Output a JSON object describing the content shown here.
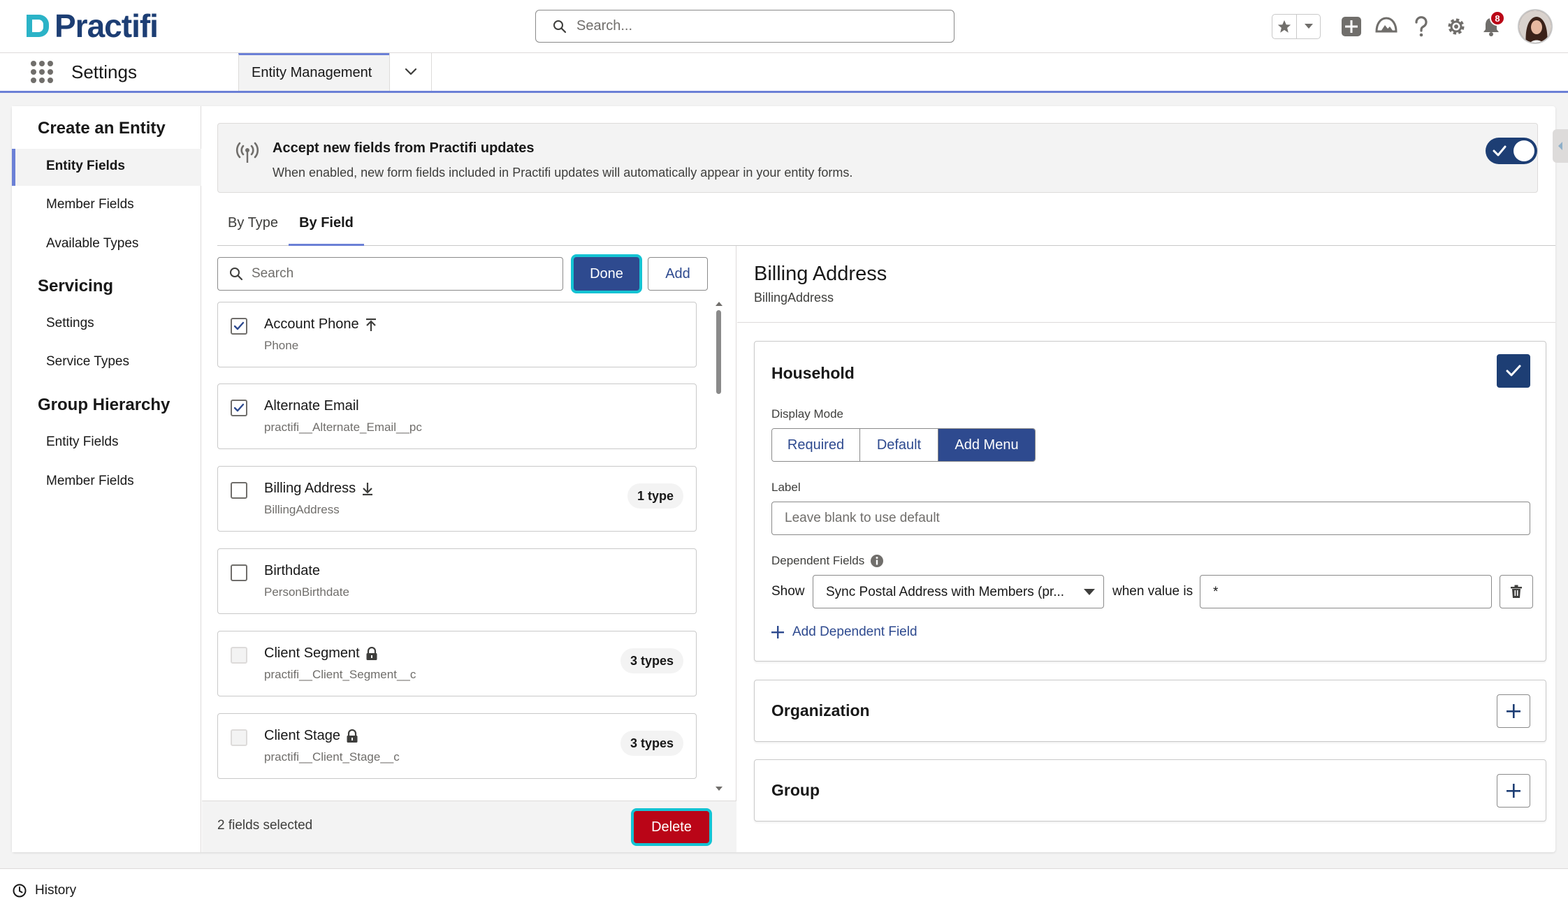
{
  "header": {
    "brand": "Practifi",
    "search_placeholder": "Search...",
    "notification_count": "8",
    "icons": [
      "favorites-star-icon",
      "chevron-down-icon",
      "add-icon",
      "trailhead-icon",
      "help-icon",
      "setup-gear-icon",
      "notification-bell-icon"
    ]
  },
  "navbar": {
    "app_name": "Settings",
    "tab_label": "Entity Management"
  },
  "sidebar": {
    "sections": [
      {
        "title": "Create an Entity",
        "items": [
          "Entity Fields",
          "Member Fields",
          "Available Types"
        ]
      },
      {
        "title": "Servicing",
        "items": [
          "Settings",
          "Service Types"
        ]
      },
      {
        "title": "Group Hierarchy",
        "items": [
          "Entity Fields",
          "Member Fields"
        ]
      }
    ],
    "active_item": "Entity Fields"
  },
  "banner": {
    "title": "Accept new fields from Practifi updates",
    "description": "When enabled, new form fields included in Practifi updates will automatically appear in your entity forms.",
    "toggle_on": true
  },
  "tabs": {
    "by_type": "By Type",
    "by_field": "By Field",
    "active": "By Field"
  },
  "field_list": {
    "search_placeholder": "Search",
    "done_label": "Done",
    "add_label": "Add",
    "fields": [
      {
        "name": "Account Phone",
        "api": "Phone",
        "checked": true,
        "disabled": false,
        "badge": "",
        "icon": "arrow-up-to-line-icon"
      },
      {
        "name": "Alternate Email",
        "api": "practifi__Alternate_Email__pc",
        "checked": true,
        "disabled": false,
        "badge": "",
        "icon": ""
      },
      {
        "name": "Billing Address",
        "api": "BillingAddress",
        "checked": false,
        "disabled": false,
        "badge": "1 type",
        "icon": "arrow-down-to-line-icon"
      },
      {
        "name": "Birthdate",
        "api": "PersonBirthdate",
        "checked": false,
        "disabled": false,
        "badge": "",
        "icon": ""
      },
      {
        "name": "Client Segment",
        "api": "practifi__Client_Segment__c",
        "checked": false,
        "disabled": true,
        "badge": "3 types",
        "icon": "lock-icon"
      },
      {
        "name": "Client Stage",
        "api": "practifi__Client_Stage__c",
        "checked": false,
        "disabled": true,
        "badge": "3 types",
        "icon": "lock-icon"
      }
    ],
    "selected_text": "2 fields selected",
    "delete_label": "Delete"
  },
  "detail": {
    "title": "Billing Address",
    "api_name": "BillingAddress",
    "household": {
      "title": "Household",
      "display_mode_label": "Display Mode",
      "modes": [
        "Required",
        "Default",
        "Add Menu"
      ],
      "selected_mode": "Add Menu",
      "label_label": "Label",
      "label_placeholder": "Leave blank to use default",
      "dependent_label": "Dependent Fields",
      "show_label": "Show",
      "dependent_select": "Sync Postal Address with Members (pr...",
      "when_label": "when value is",
      "when_value": "*",
      "add_dependent": "Add Dependent Field"
    },
    "organization_title": "Organization",
    "group_title": "Group"
  },
  "utility": {
    "history_label": "History"
  },
  "colors": {
    "brand_navy": "#1d3e74",
    "button_blue": "#2e4a8f",
    "accent_periwinkle": "#6b80d6",
    "delete_red": "#ba0517",
    "focus_cyan": "#14c3d3"
  }
}
